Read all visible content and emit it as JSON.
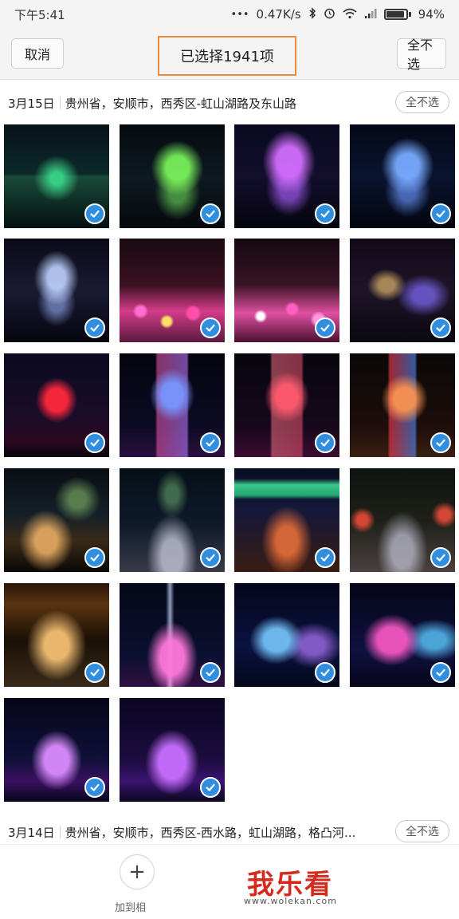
{
  "status_bar": {
    "time": "下午5:41",
    "speed": "0.47K/s",
    "battery": "94%",
    "battery_level": 0.94,
    "icons": [
      "dots-icon",
      "bluetooth-icon",
      "alarm-icon",
      "wifi-icon",
      "signal-icon",
      "battery-icon"
    ]
  },
  "action_bar": {
    "cancel_label": "取消",
    "title": "已选择1941项",
    "deselect_label": "全不选"
  },
  "sections": [
    {
      "date": "3月15日",
      "location": "贵州省，安顺市，西秀区-虹山湖路及东山路",
      "pill_label": "全不选"
    },
    {
      "date": "3月14日",
      "location": "贵州省，安顺市，西秀区-西水路，虹山湖路，格凸河...",
      "pill_label": "全不选"
    }
  ],
  "photos": [
    {
      "scene": "night-lake-green-lights",
      "selected": true
    },
    {
      "scene": "hill-green-lights-reflection",
      "selected": true
    },
    {
      "scene": "purple-hill-reflection",
      "selected": true
    },
    {
      "scene": "blue-hill-reflection",
      "selected": true
    },
    {
      "scene": "lit-hill-reflection",
      "selected": true
    },
    {
      "scene": "flower-light-field",
      "selected": true
    },
    {
      "scene": "flower-light-field-2",
      "selected": true
    },
    {
      "scene": "rock-garden-lights",
      "selected": true
    },
    {
      "scene": "red-light-tower",
      "selected": true
    },
    {
      "scene": "light-cylinder-blue",
      "selected": true
    },
    {
      "scene": "light-cylinder-red",
      "selected": true
    },
    {
      "scene": "light-cylinder-colorful",
      "selected": true
    },
    {
      "scene": "boardwalk-lake-night",
      "selected": true
    },
    {
      "scene": "bridge-walkway-night",
      "selected": true
    },
    {
      "scene": "pavilion-green-roof",
      "selected": true
    },
    {
      "scene": "wooden-walkway-lanterns",
      "selected": true
    },
    {
      "scene": "corridor-warm-lights",
      "selected": true
    },
    {
      "scene": "fountain-pink",
      "selected": true
    },
    {
      "scene": "fountain-blue",
      "selected": true
    },
    {
      "scene": "fountain-pink-blue",
      "selected": true
    },
    {
      "scene": "fountain-purple",
      "selected": true
    },
    {
      "scene": "fountain-violet",
      "selected": true
    }
  ],
  "bottom_bar": {
    "add_icon": "plus-icon",
    "add_label": "加到相",
    "watermark_logo": "我乐看",
    "watermark_url": "www.wolekan.com"
  },
  "colors": {
    "accent": "#2f8ee0",
    "highlight_border": "#f08a3c",
    "watermark": "#d52b1e"
  }
}
